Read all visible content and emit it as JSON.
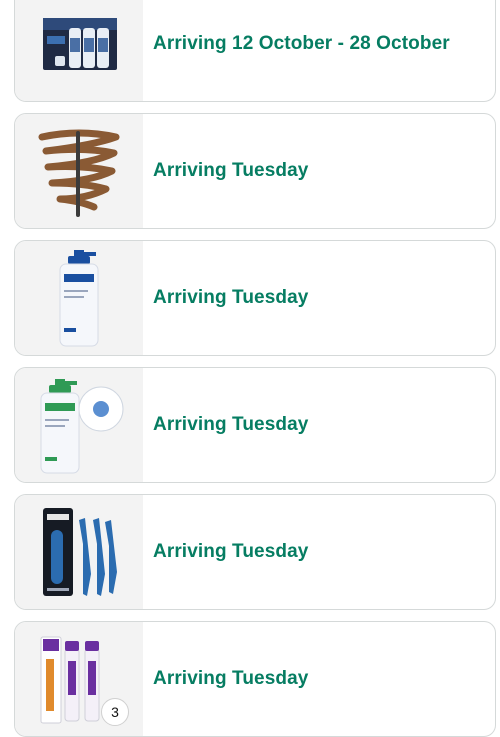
{
  "orders": [
    {
      "status": "Arriving 12 October - 28 October",
      "product_icon": "hair-treatment-kit-icon"
    },
    {
      "status": "Arriving Tuesday",
      "product_icon": "eyebrow-pencil-icon"
    },
    {
      "status": "Arriving Tuesday",
      "product_icon": "cerave-lotion-bottle-icon"
    },
    {
      "status": "Arriving Tuesday",
      "product_icon": "cerave-cleanser-bottle-icon"
    },
    {
      "status": "Arriving Tuesday",
      "product_icon": "razor-set-icon"
    },
    {
      "status": "Arriving Tuesday",
      "product_icon": "azelaic-acid-cream-icon",
      "quantity": "3"
    }
  ],
  "colors": {
    "status_green": "#067d62",
    "card_border": "#d5d9d9",
    "thumb_bg": "#f3f3f3"
  }
}
